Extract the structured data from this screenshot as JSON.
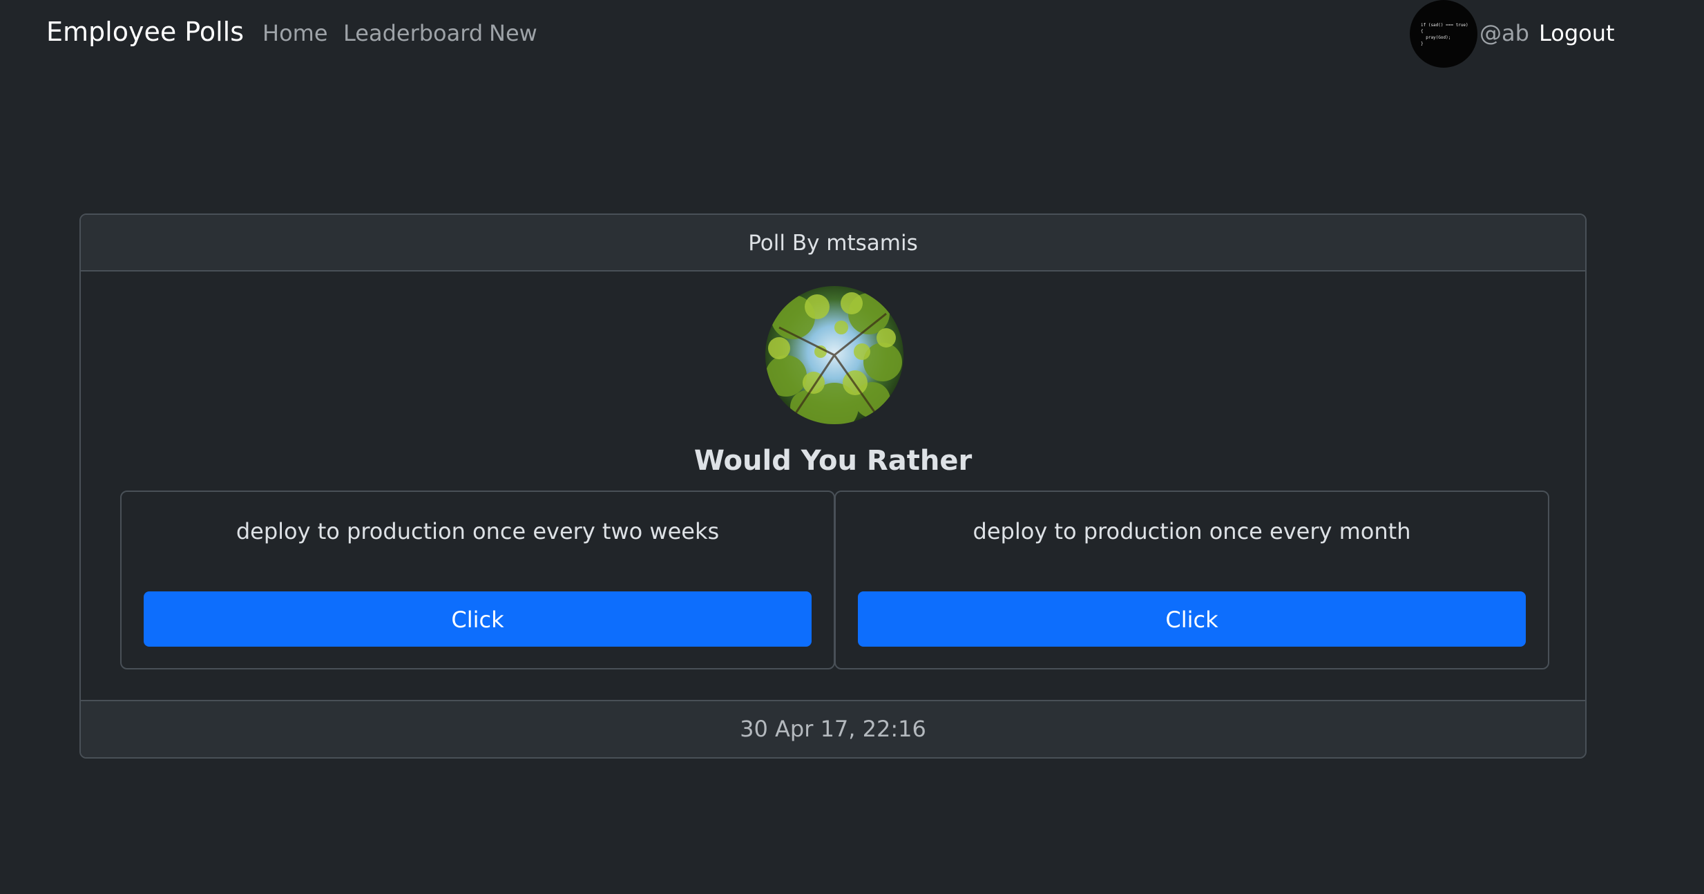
{
  "navbar": {
    "brand": "Employee Polls",
    "links": [
      "Home",
      "Leaderboard",
      "New"
    ],
    "user_handle": "@ab",
    "logout_label": "Logout",
    "avatar_code": "if (sad() === true)\n{\n  pray(God);\n}"
  },
  "poll": {
    "header": "Poll By mtsamis",
    "title": "Would You Rather",
    "options": [
      {
        "text": "deploy to production once every two weeks",
        "button_label": "Click"
      },
      {
        "text": "deploy to production once every month",
        "button_label": "Click"
      }
    ],
    "timestamp": "30 Apr 17, 22:16"
  },
  "colors": {
    "background": "#212529",
    "accent": "#0d6efd",
    "border": "#495057",
    "card_header": "#2b3035"
  },
  "icons": {
    "user_avatar": "code-snippet-avatar",
    "poll_avatar": "tree-canopy-photo"
  }
}
